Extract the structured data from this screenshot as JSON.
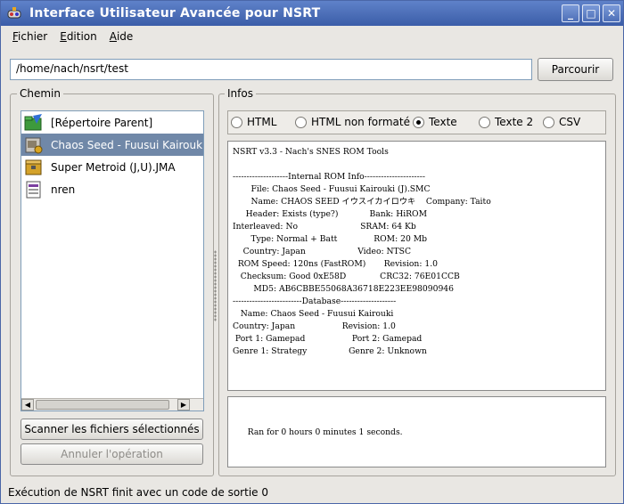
{
  "window": {
    "title": "Interface Utilisateur Avancée pour NSRT",
    "minimize_glyph": "_",
    "maximize_glyph": "□",
    "close_glyph": "✕"
  },
  "menu": {
    "fichier": {
      "first": "F",
      "rest": "ichier"
    },
    "edition": {
      "first": "E",
      "rest": "dition"
    },
    "aide": {
      "first": "A",
      "rest": "ide"
    }
  },
  "path": {
    "value": "/home/nach/nsrt/test",
    "browse_label": "Parcourir"
  },
  "chemin": {
    "title": "Chemin",
    "items": [
      {
        "label": "[Répertoire Parent]",
        "icon": "folder-up-icon"
      },
      {
        "label": "Chaos Seed - Fuusui Kairouki",
        "icon": "rom-file-icon"
      },
      {
        "label": "Super Metroid (J,U).JMA",
        "icon": "archive-file-icon"
      },
      {
        "label": "nren",
        "icon": "text-file-icon"
      }
    ],
    "scan_label": "Scanner les fichiers sélectionnés",
    "cancel_label": "Annuler l'opération",
    "scroll_left": "◀",
    "scroll_right": "▶"
  },
  "infos": {
    "title": "Infos",
    "formats": [
      {
        "label": "HTML",
        "selected": false
      },
      {
        "label": "HTML non formaté",
        "selected": false
      },
      {
        "label": "Texte",
        "selected": true
      },
      {
        "label": "Texte 2",
        "selected": false
      },
      {
        "label": "CSV",
        "selected": false
      }
    ],
    "output_lines": [
      "NSRT v3.3 - Nach's SNES ROM Tools",
      "",
      "--------------------Internal ROM Info----------------------",
      "       File: Chaos Seed - Fuusui Kairouki (J).SMC",
      "       Name: CHAOS SEED イウスイカイロウキ    Company: Taito",
      "     Header: Exists (type?)            Bank: HiROM",
      "Interleaved: No                        SRAM: 64 Kb",
      "       Type: Normal + Batt              ROM: 20 Mb",
      "    Country: Japan                    Video: NTSC",
      "  ROM Speed: 120ns (FastROM)       Revision: 1.0",
      "   Checksum: Good 0xE58D             CRC32: 76E01CCB",
      "        MD5: AB6CBBE55068A36718E223EE98090946",
      "-------------------------Database--------------------",
      "   Name: Chaos Seed - Fuusui Kairouki",
      "Country: Japan                  Revision: 1.0",
      " Port 1: Gamepad                  Port 2: Gamepad",
      "Genre 1: Strategy                Genre 2: Unknown"
    ],
    "log_text": "Ran for 0 hours 0 minutes 1 seconds."
  },
  "status_bar": {
    "text": "Exécution de NSRT finit avec un code de sortie 0"
  },
  "colors": {
    "titlebar": "#3b5da8",
    "selection": "#7088a8"
  }
}
